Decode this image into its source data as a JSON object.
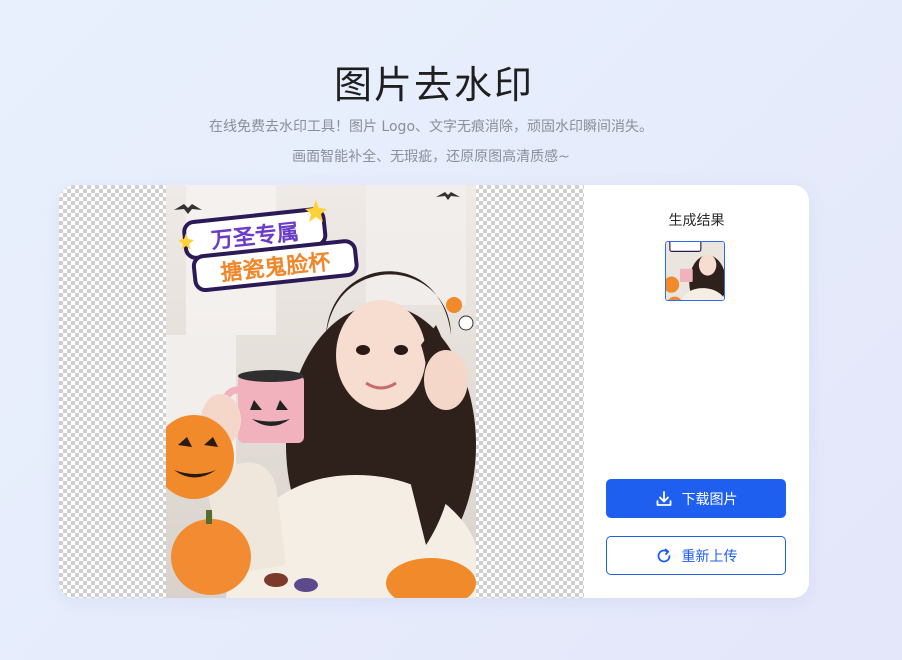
{
  "header": {
    "title": "图片去水印",
    "subtitle_line1": "在线免费去水印工具！图片 Logo、文字无痕消除，顽固水印瞬间消失。",
    "subtitle_line2": "画面智能补全、无瑕疵，还原原图高清质感~"
  },
  "editor": {
    "photo": {
      "sticker_line1": "万圣专属",
      "sticker_line2": "搪瓷鬼脸杯"
    },
    "side": {
      "result_label": "生成结果",
      "download_label": "下载图片",
      "download_icon": "download-icon",
      "reupload_label": "重新上传",
      "reupload_icon": "refresh-icon"
    }
  },
  "colors": {
    "accent": "#1f5ff0",
    "title": "#1f1f1f",
    "subtitle": "#8a8f99",
    "pumpkin": "#f08a2a",
    "mug": "#f2b2bd"
  }
}
